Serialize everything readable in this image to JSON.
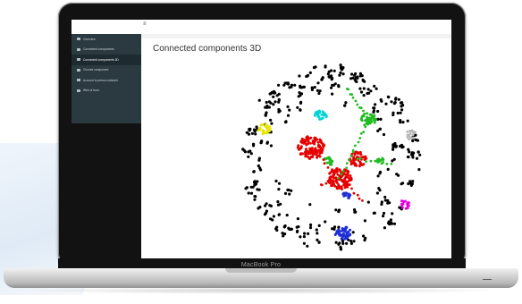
{
  "window": {
    "brand_label": "MacBook Pro",
    "menu_glyph": "≡"
  },
  "sidebar": {
    "items": [
      {
        "label": "Overview",
        "icon": "dashboard-icon",
        "active": false
      },
      {
        "label": "Connected components",
        "icon": "table-icon",
        "active": false
      },
      {
        "label": "Connected components 3D",
        "icon": "cube-icon",
        "active": true
      },
      {
        "label": "Choose component",
        "icon": "list-icon",
        "active": false
      },
      {
        "label": "Account to person network",
        "icon": "table-icon",
        "active": false
      },
      {
        "label": "Web of trust",
        "icon": "table-icon",
        "active": false
      }
    ]
  },
  "main": {
    "title": "Connected components 3D"
  },
  "graph": {
    "type": "3d-network-scatter",
    "clusters": [
      {
        "color": "#e60000",
        "size": "large"
      },
      {
        "color": "#e60000",
        "size": "large"
      },
      {
        "color": "#e60000",
        "size": "medium"
      },
      {
        "color": "#22bb22",
        "size": "medium"
      },
      {
        "color": "#22bb22",
        "size": "medium"
      },
      {
        "color": "#22bb22",
        "size": "small"
      },
      {
        "color": "#1f2fd6",
        "size": "medium"
      },
      {
        "color": "#1f2fd6",
        "size": "small"
      },
      {
        "color": "#00d4d4",
        "size": "small"
      },
      {
        "color": "#e6e600",
        "size": "small"
      },
      {
        "color": "#e600e6",
        "size": "small"
      },
      {
        "color": "#b8b8b8",
        "size": "small"
      }
    ],
    "background_color": "#000000"
  }
}
